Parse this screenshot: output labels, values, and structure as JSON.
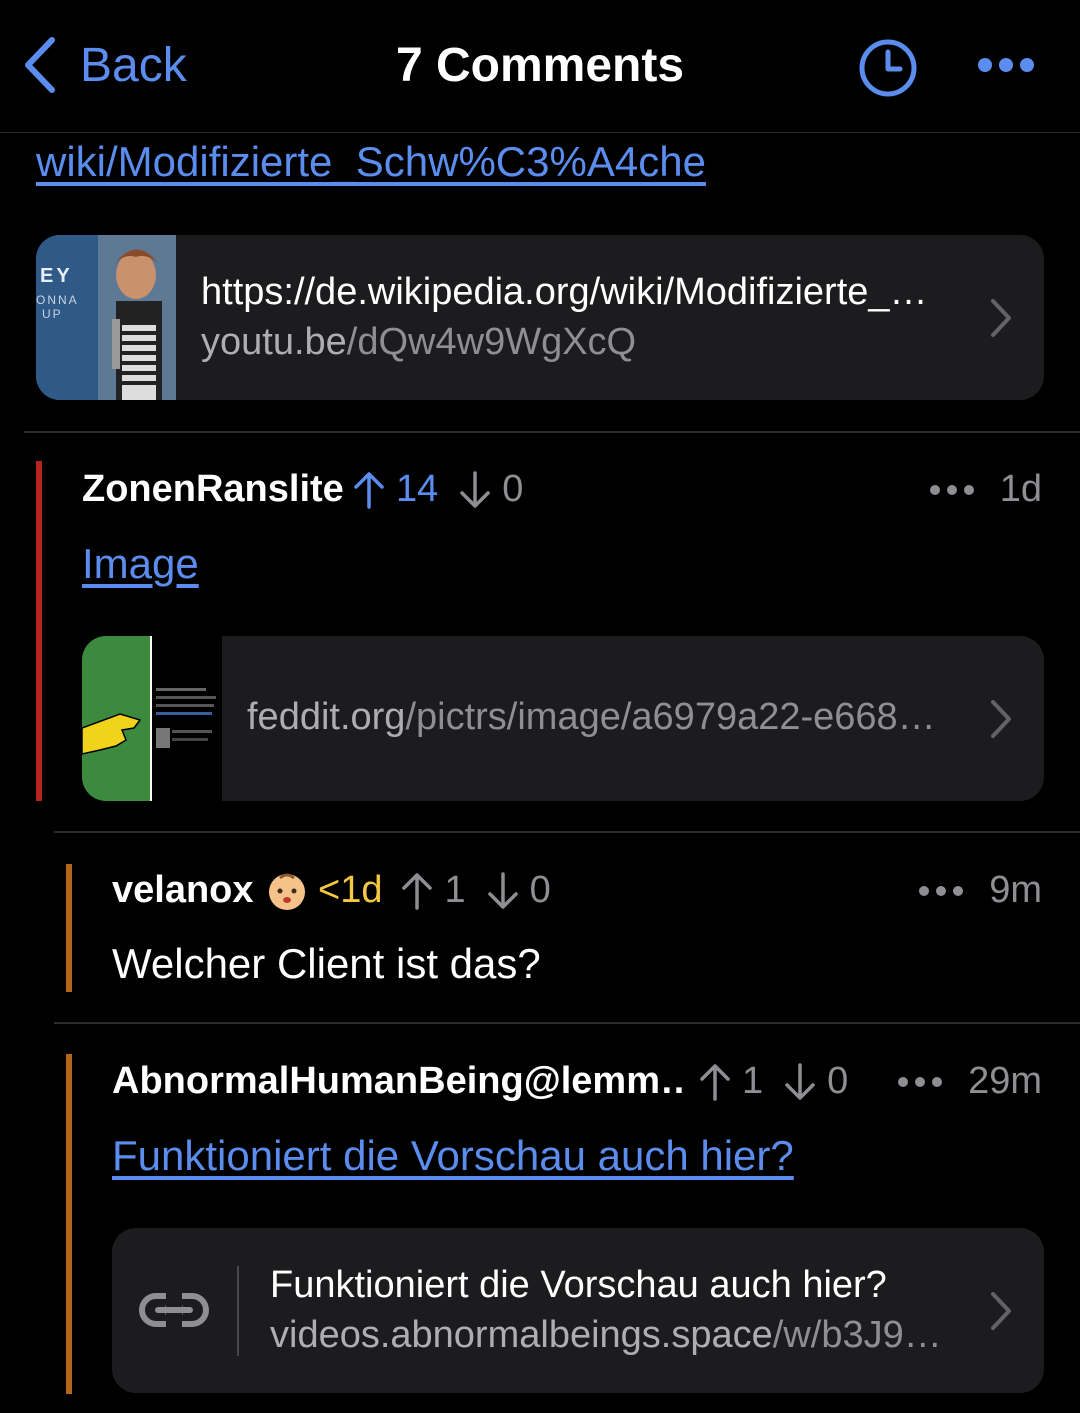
{
  "nav": {
    "back_label": "Back",
    "title": "7 Comments"
  },
  "post": {
    "link_text": "wiki/Modifizierte_Schw%C3%A4che",
    "card": {
      "title": "https://de.wikipedia.org/wiki/Modifizierte_…",
      "url_domain": "youtu.be",
      "url_path": "/dQw4w9WgXcQ",
      "thumb_text_lines": [
        "EY",
        "ONNA",
        "UP"
      ]
    }
  },
  "comments": [
    {
      "author": "ZonenRanslite",
      "upvotes": "14",
      "downvotes": "0",
      "time": "1d",
      "link_text": "Image",
      "card": {
        "url_domain": "feddit.org",
        "url_path": "/pictrs/image/a6979a22-e668…"
      },
      "bar_color": "#b3261e"
    },
    {
      "author": "velanox",
      "badge_text": "<1d",
      "upvotes": "1",
      "downvotes": "0",
      "time": "9m",
      "body": "Welcher Client ist das?",
      "bar_color": "#b5651d"
    },
    {
      "author": "AbnormalHumanBeing@lemm…",
      "upvotes": "1",
      "downvotes": "0",
      "time": "29m",
      "link_text": "Funktioniert die Vorschau auch hier?",
      "card": {
        "title": "Funktioniert die Vorschau auch hier?",
        "url_domain": "videos.abnormalbeings.space",
        "url_path": "/w/b3J9…"
      },
      "bar_color": "#b5651d"
    }
  ],
  "colors": {
    "accent": "#5b8def",
    "badge": "#f5c842",
    "card_bg": "#1c1c1e"
  },
  "icons": [
    "chevron-left-icon",
    "clock-icon",
    "more-icon",
    "chevron-right-icon",
    "arrow-up-icon",
    "arrow-down-icon",
    "baby-icon",
    "link-icon"
  ]
}
